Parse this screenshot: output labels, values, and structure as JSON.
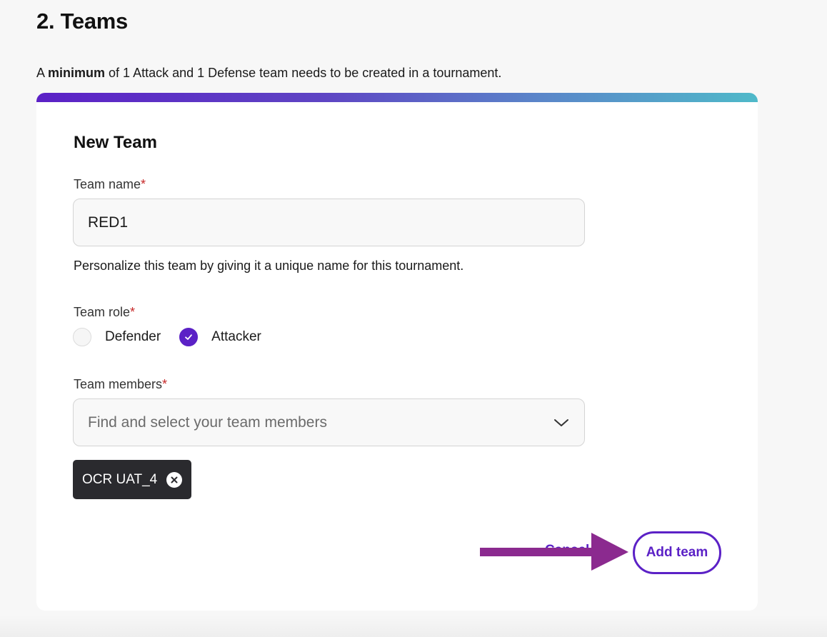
{
  "section": {
    "title": "2. Teams",
    "intro_prefix": "A ",
    "intro_bold": "minimum",
    "intro_suffix": " of 1 Attack and 1 Defense team needs to be created in a tournament."
  },
  "form": {
    "title": "New Team",
    "required_mark": "*",
    "team_name": {
      "label": "Team name",
      "value": "RED1",
      "helper": "Personalize this team by giving it a unique name for this tournament."
    },
    "team_role": {
      "label": "Team role",
      "options": [
        {
          "label": "Defender",
          "selected": false
        },
        {
          "label": "Attacker",
          "selected": true
        }
      ]
    },
    "team_members": {
      "label": "Team members",
      "placeholder": "Find and select your team members",
      "selected": [
        "OCR UAT_4"
      ]
    },
    "actions": {
      "cancel_label": "Cancel",
      "add_label": "Add team"
    }
  },
  "colors": {
    "accent": "#5b21c6",
    "arrow": "#8b2a8f",
    "required": "#c62828",
    "chip_bg": "#2a2a2e"
  },
  "icons": {
    "radio_check": "check-icon",
    "select_chevron": "chevron-down-icon",
    "chip_remove": "close-circle-icon",
    "annotation": "arrow-right-icon"
  }
}
